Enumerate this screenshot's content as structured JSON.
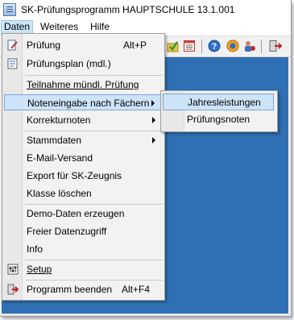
{
  "window": {
    "title": "SK-Prüfungsprogramm HAUPTSCHULE 13.1.001"
  },
  "menubar": {
    "items": [
      {
        "label": "Daten"
      },
      {
        "label": "Weiteres"
      },
      {
        "label": "Hilfe"
      }
    ]
  },
  "toolbar": {
    "icons": [
      "checkmark-folder-icon",
      "table-icon",
      "help-icon",
      "lifebuoy-icon",
      "user-config-icon",
      "exit-icon"
    ]
  },
  "menu": {
    "items": [
      {
        "label": "Prüfung",
        "shortcut": "Alt+P"
      },
      {
        "label": "Prüfungsplan (mdl.)"
      },
      {
        "label": "Teilnahme mündl. Prüfung"
      },
      {
        "label": "Noteneingabe nach Fächern"
      },
      {
        "label": "Korrekturnoten"
      },
      {
        "label": "Stammdaten"
      },
      {
        "label": "E-Mail-Versand"
      },
      {
        "label": "Export für SK-Zeugnis"
      },
      {
        "label": "Klasse löschen"
      },
      {
        "label": "Demo-Daten erzeugen"
      },
      {
        "label": "Freier Datenzugriff"
      },
      {
        "label": "Info"
      },
      {
        "label": "Setup"
      },
      {
        "label": "Programm beenden",
        "shortcut": "Alt+F4"
      }
    ]
  },
  "submenu": {
    "items": [
      {
        "label": "Jahresleistungen"
      },
      {
        "label": "Prüfungsnoten"
      }
    ]
  },
  "colors": {
    "desktop_blue": "#2f6fb3",
    "highlight": "#cde3f8"
  }
}
